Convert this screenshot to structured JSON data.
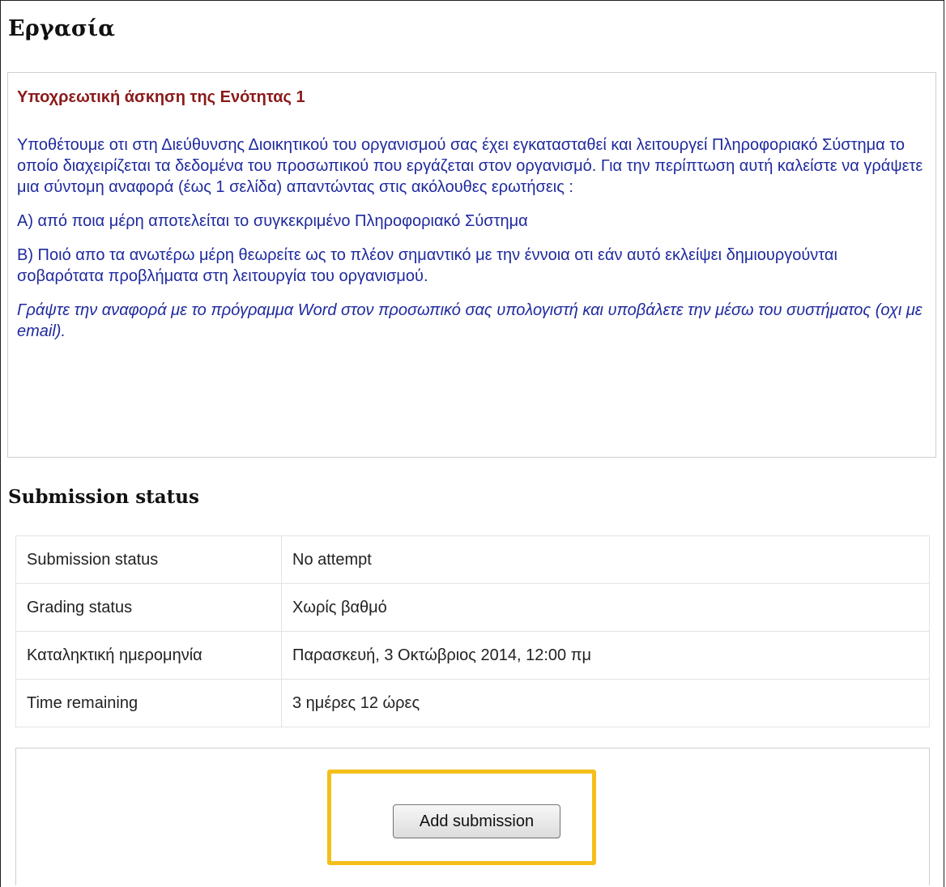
{
  "page": {
    "title": "Εργασία"
  },
  "intro": {
    "heading": "Υποχρεωτική άσκηση της Ενότητας 1",
    "paragraphs": [
      "Υποθέτουμε οτι στη Διεύθυνσης Διοικητικού του οργανισμού  σας  έχει εγκατασταθεί και λειτουργεί  Πληροφοριακό Σύστημα το οποίο  διαχειρίζεται τα δεδομένα του προσωπικού που εργάζεται στον οργανισμό. Για την περίπτωση αυτή καλείστε να γράψετε μια σύντομη αναφορά (έως 1 σελίδα) απαντώντας στις ακόλουθες ερωτήσεις :",
      "Α) από ποια μέρη αποτελείται το συγκεκριμένο Πληροφοριακό Σύστημα",
      "Β) Ποιό απο τα ανωτέρω μέρη θεωρείτε ως το πλέον σημαντικό με την έννοια οτι εάν αυτό εκλείψει δημιουργούνται σοβαρότατα προβλήματα στη λειτουργία του οργανισμού."
    ],
    "note": "Γράψτε την αναφορά με το πρόγραμμα Word στον προσωπικό σας υπολογιστή και υποβάλετε την μέσω του συστήματος (οχι με email)."
  },
  "submission": {
    "section_title": "Submission status",
    "rows": [
      {
        "label": "Submission status",
        "value": "No attempt"
      },
      {
        "label": "Grading status",
        "value": "Χωρίς βαθμό"
      },
      {
        "label": "Καταληκτική ημερομηνία",
        "value": "Παρασκευή, 3 Οκτώβριος 2014, 12:00 πμ"
      },
      {
        "label": "Time remaining",
        "value": "3 ημέρες 12 ώρες"
      }
    ],
    "add_button_label": "Add submission"
  },
  "colors": {
    "heading_red": "#8b1a1a",
    "body_blue": "#1f2a9e",
    "highlight_yellow": "#f4bf1a"
  }
}
